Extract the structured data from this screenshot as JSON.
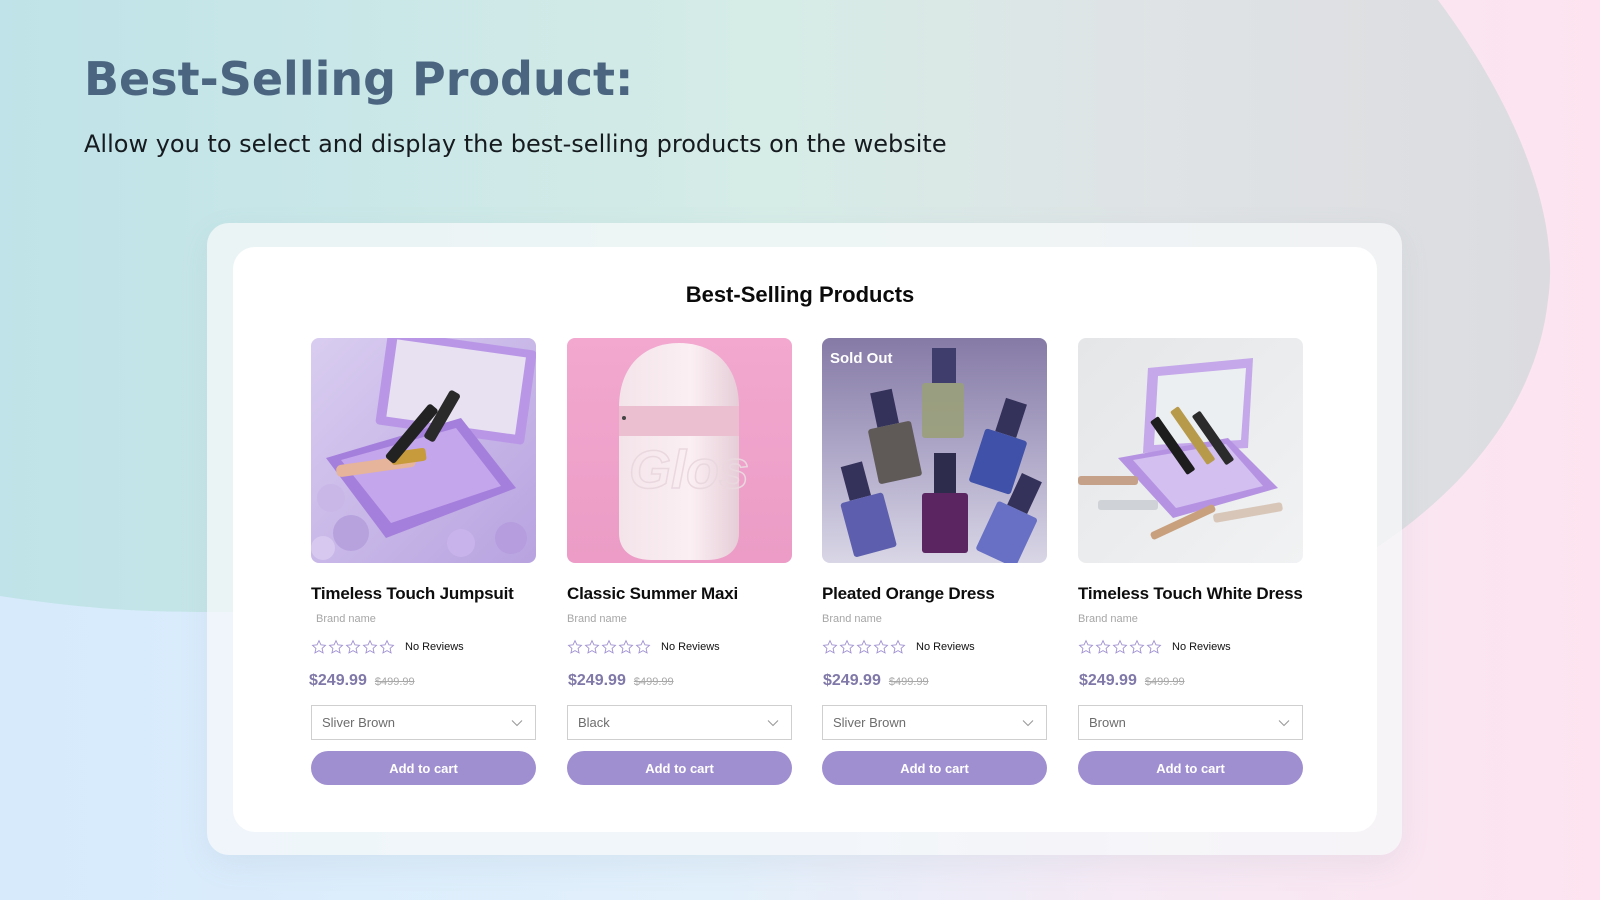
{
  "hero": {
    "title": "Best-Selling Product:",
    "subtitle": "Allow you to select and display the best-selling products on the website"
  },
  "panel": {
    "title": "Best-Selling Products"
  },
  "colors": {
    "accent": "#9f8fd1",
    "price": "#7f78a8",
    "star_outline": "#9f8fd1",
    "heading": "#4b6580"
  },
  "products": [
    {
      "name": "Timeless Touch Jumpsuit",
      "brand": "Brand name",
      "rating_stars": 0,
      "reviews": "No Reviews",
      "price": "$249.99",
      "compare_price": "$499.99",
      "variant": "Sliver Brown",
      "cart_label": "Add to cart",
      "badge": "",
      "image": "lavender-makeup-case-with-lip-glosses"
    },
    {
      "name": "Classic Summer Maxi",
      "brand": "Brand name",
      "rating_stars": 0,
      "reviews": "No Reviews",
      "price": "$249.99",
      "compare_price": "$499.99",
      "variant": "Black",
      "cart_label": "Add to cart",
      "badge": "",
      "image": "white-bottle-on-pink-background",
      "image_text": "Glos"
    },
    {
      "name": "Pleated Orange Dress",
      "brand": "Brand name",
      "rating_stars": 0,
      "reviews": "No Reviews",
      "price": "$249.99",
      "compare_price": "$499.99",
      "variant": "Sliver Brown",
      "cart_label": "Add to cart",
      "badge": "Sold Out",
      "image": "nail-polish-bottles"
    },
    {
      "name": "Timeless Touch White Dress",
      "brand": "Brand name",
      "rating_stars": 0,
      "reviews": "No Reviews",
      "price": "$249.99",
      "compare_price": "$499.99",
      "variant": "Brown",
      "cart_label": "Add to cart",
      "badge": "",
      "image": "lavender-case-with-lip-products-on-grey"
    }
  ]
}
